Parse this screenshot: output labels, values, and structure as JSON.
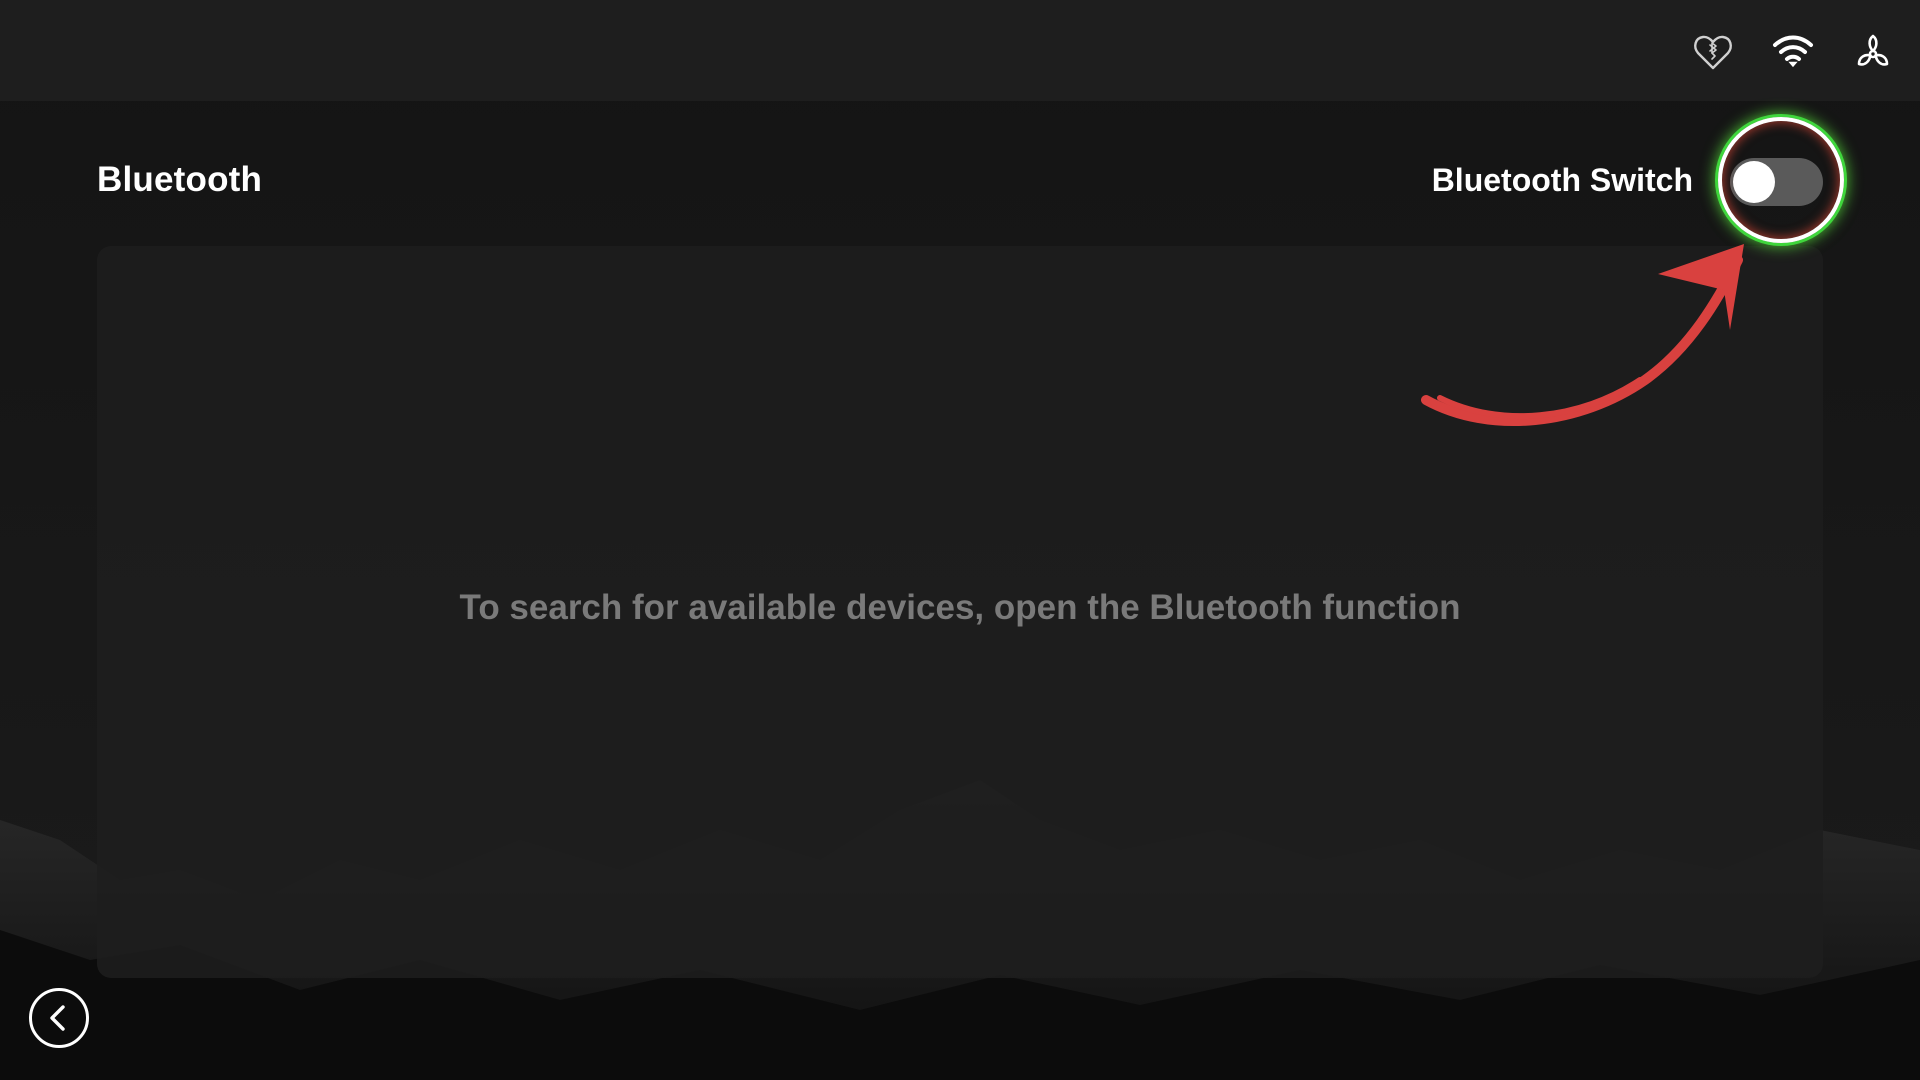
{
  "header": {
    "title": "Bluetooth"
  },
  "status_bar": {
    "icons": [
      "broken-heart-bluetooth-icon",
      "wifi-icon",
      "fan-icon"
    ]
  },
  "bluetooth_switch": {
    "label": "Bluetooth Switch",
    "state": "off"
  },
  "device_list": {
    "empty_message": "To search for available devices, open the Bluetooth function"
  },
  "navigation": {
    "back_icon": "chevron-left-icon"
  },
  "colors": {
    "highlight_ring": "#3fd63c",
    "annotation_arrow": "#d9413f",
    "toggle_track_off": "#5a5a5a"
  }
}
